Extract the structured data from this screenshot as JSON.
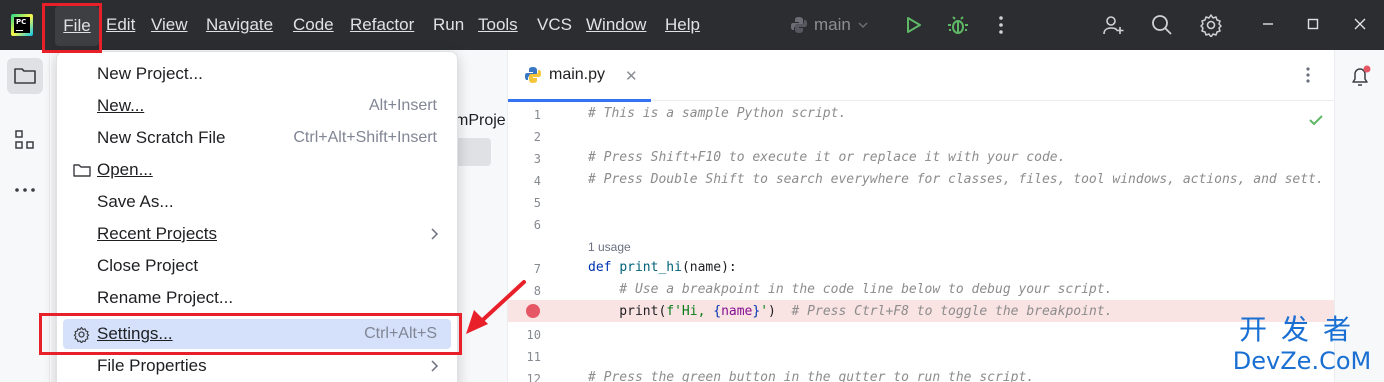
{
  "titlebar": {
    "menu": [
      {
        "id": "file",
        "label": "File"
      },
      {
        "id": "edit",
        "label": "Edit"
      },
      {
        "id": "view",
        "label": "View"
      },
      {
        "id": "navigate",
        "label": "Navigate"
      },
      {
        "id": "code",
        "label": "Code"
      },
      {
        "id": "refactor",
        "label": "Refactor"
      },
      {
        "id": "run",
        "label": "Run"
      },
      {
        "id": "tools",
        "label": "Tools"
      },
      {
        "id": "vcs",
        "label": "VCS"
      },
      {
        "id": "window",
        "label": "Window"
      },
      {
        "id": "help",
        "label": "Help"
      }
    ],
    "run_config": "main",
    "logo_text": "PC"
  },
  "project_panel": {
    "partial_title": "mProje"
  },
  "file_menu": {
    "items": [
      {
        "label": "New Project...",
        "shortcut": ""
      },
      {
        "label": "New...",
        "shortcut": "Alt+Insert"
      },
      {
        "label": "New Scratch File",
        "shortcut": "Ctrl+Alt+Shift+Insert"
      },
      {
        "label": "Open...",
        "shortcut": ""
      },
      {
        "label": "Save As...",
        "shortcut": ""
      },
      {
        "label": "Recent Projects",
        "shortcut": ""
      },
      {
        "label": "Close Project",
        "shortcut": ""
      },
      {
        "label": "Rename Project...",
        "shortcut": ""
      },
      {
        "label": "Settings...",
        "shortcut": "Ctrl+Alt+S"
      },
      {
        "label": "File Properties",
        "shortcut": ""
      }
    ]
  },
  "editor": {
    "tab_label": "main.py",
    "line_numbers": [
      "1",
      "2",
      "3",
      "4",
      "5",
      "6",
      "7",
      "8",
      "",
      "10",
      "11",
      "12"
    ],
    "usage_hint": "1 usage",
    "code_lines": {
      "l1": "# This is a sample Python script.",
      "l3": "# Press Shift+F10 to execute it or replace it with your code.",
      "l4": "# Press Double Shift to search everywhere for classes, files, tool windows, actions, and sett.",
      "l7_kw": "def",
      "l7_fn": "print_hi",
      "l7_rest": "(name):",
      "l8": "    # Use a breakpoint in the code line below to debug your script.",
      "l9_fn": "    print",
      "l9_open": "(",
      "l9_str1": "f'Hi, ",
      "l9_brace_open": "{",
      "l9_var": "name",
      "l9_brace_close": "}",
      "l9_str2": "'",
      "l9_close": ")",
      "l9_comment": "  # Press Ctrl+F8 to toggle the breakpoint.",
      "l12": "# Press the green button in the gutter to run the script."
    }
  },
  "watermark": {
    "line1": "开发者",
    "line2": "DevZe.CoM"
  },
  "colors": {
    "titlebar_bg": "#2b2d30",
    "highlight": "#d5e1fb",
    "annotation_red": "#e8202a",
    "accent_blue": "#3574f0"
  }
}
